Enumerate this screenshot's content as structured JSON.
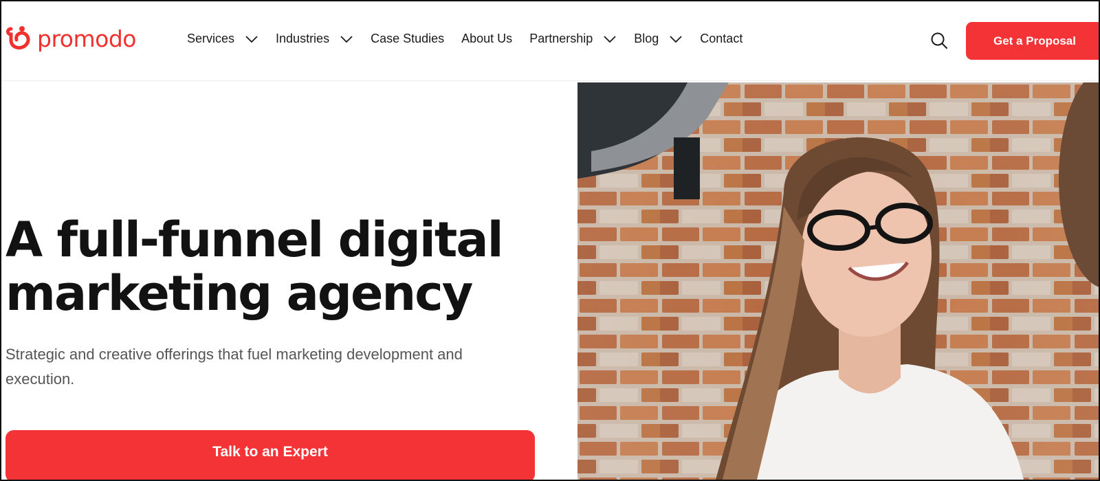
{
  "brand": {
    "name": "promodo",
    "color": "#f2312f"
  },
  "nav": {
    "items": [
      {
        "label": "Services",
        "dropdown": true
      },
      {
        "label": "Industries",
        "dropdown": true
      },
      {
        "label": "Case Studies",
        "dropdown": false
      },
      {
        "label": "About Us",
        "dropdown": false
      },
      {
        "label": "Partnership",
        "dropdown": true
      },
      {
        "label": "Blog",
        "dropdown": true
      },
      {
        "label": "Contact",
        "dropdown": false
      }
    ],
    "search_icon": "search-icon",
    "cta_label": "Get a Proposal"
  },
  "hero": {
    "title_line1": "A full-funnel digital",
    "title_line2": "marketing agency",
    "subtitle": "Strategic and creative offerings that fuel marketing development and execution.",
    "cta_label": "Talk to an Expert"
  },
  "colors": {
    "accent": "#f43336",
    "text": "#121212",
    "muted": "#555555"
  }
}
